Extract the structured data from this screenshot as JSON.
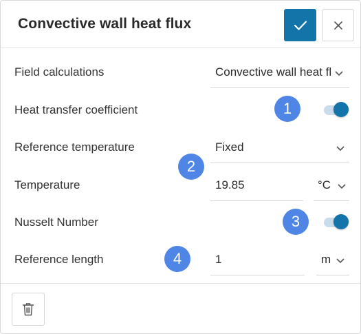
{
  "header": {
    "title": "Convective wall heat flux",
    "confirm_icon": "check-icon",
    "close_icon": "close-icon"
  },
  "rows": {
    "field_calculations": {
      "label": "Field calculations",
      "value": "Convective wall heat flux"
    },
    "heat_transfer_coefficient": {
      "label": "Heat transfer coefficient",
      "enabled": true
    },
    "reference_temperature": {
      "label": "Reference temperature",
      "value": "Fixed"
    },
    "temperature": {
      "label": "Temperature",
      "value": "19.85",
      "unit": "°C"
    },
    "nusselt_number": {
      "label": "Nusselt Number",
      "enabled": true
    },
    "reference_length": {
      "label": "Reference length",
      "value": "1",
      "unit": "m"
    }
  },
  "badges": [
    "1",
    "2",
    "3",
    "4"
  ],
  "footer": {
    "delete_icon": "trash-icon"
  },
  "colors": {
    "accent": "#1274a8",
    "badge": "#4f86e6",
    "toggle_track": "#c9dcec"
  }
}
